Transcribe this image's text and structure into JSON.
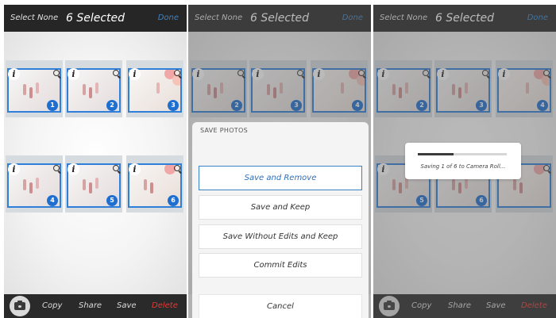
{
  "colors": {
    "accent": "#3b82c4",
    "badge": "#1e6fd0",
    "delete": "#e53935",
    "bar": "#262626"
  },
  "topbar": {
    "select_none": "Select None",
    "title": "6 Selected",
    "done": "Done"
  },
  "bottombar": {
    "camera_icon": "camera-icon",
    "copy": "Copy",
    "share": "Share",
    "save": "Save",
    "delete": "Delete"
  },
  "photos": [
    {
      "badge": "1",
      "info": "i"
    },
    {
      "badge": "2",
      "info": "i"
    },
    {
      "badge": "3",
      "info": "i"
    },
    {
      "badge": "4",
      "info": "i"
    },
    {
      "badge": "5",
      "info": "i"
    },
    {
      "badge": "6",
      "info": "i"
    }
  ],
  "save_sheet": {
    "title": "SAVE PHOTOS",
    "options": [
      "Save and Remove",
      "Save and Keep",
      "Save Without Edits and Keep",
      "Commit Edits"
    ],
    "cancel": "Cancel"
  },
  "progress": {
    "text": "Saving 1 of 6 to Camera Roll...",
    "fraction": 0.4
  }
}
